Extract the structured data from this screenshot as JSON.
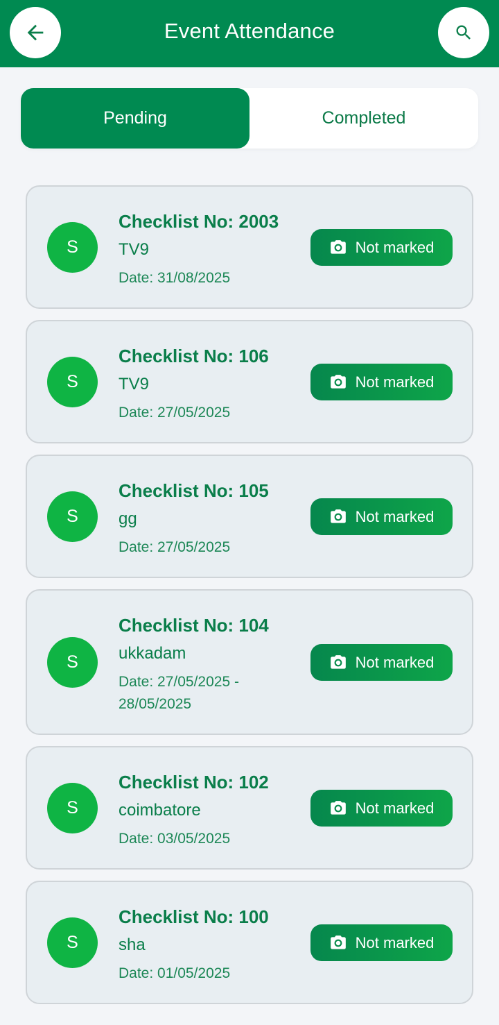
{
  "app_bar": {
    "title": "Event Attendance",
    "back_icon": "arrow-left-icon",
    "search_icon": "search-icon"
  },
  "tabs": [
    {
      "label": "Pending",
      "selected": true
    },
    {
      "label": "Completed",
      "selected": false
    }
  ],
  "colors": {
    "primary": "#008a51",
    "avatar": "#0fb444",
    "text_green": "#0a7e4a",
    "card_bg": "#e8eef2"
  },
  "checklists": [
    {
      "avatar": "S",
      "title": "Checklist No: 2003",
      "subtitle": "TV9",
      "date": "Date: 31/08/2025",
      "status": "Not marked",
      "status_icon": "camera-icon"
    },
    {
      "avatar": "S",
      "title": "Checklist No: 106",
      "subtitle": "TV9",
      "date": "Date: 27/05/2025",
      "status": "Not marked",
      "status_icon": "camera-icon"
    },
    {
      "avatar": "S",
      "title": "Checklist No: 105",
      "subtitle": "gg",
      "date": "Date: 27/05/2025",
      "status": "Not marked",
      "status_icon": "camera-icon"
    },
    {
      "avatar": "S",
      "title": "Checklist No: 104",
      "subtitle": "ukkadam",
      "date": "Date: 27/05/2025 - 28/05/2025",
      "status": "Not marked",
      "status_icon": "camera-icon"
    },
    {
      "avatar": "S",
      "title": "Checklist No: 102",
      "subtitle": "coimbatore",
      "date": "Date: 03/05/2025",
      "status": "Not marked",
      "status_icon": "camera-icon"
    },
    {
      "avatar": "S",
      "title": "Checklist No: 100",
      "subtitle": "sha",
      "date": "Date: 01/05/2025",
      "status": "Not marked",
      "status_icon": "camera-icon"
    }
  ]
}
